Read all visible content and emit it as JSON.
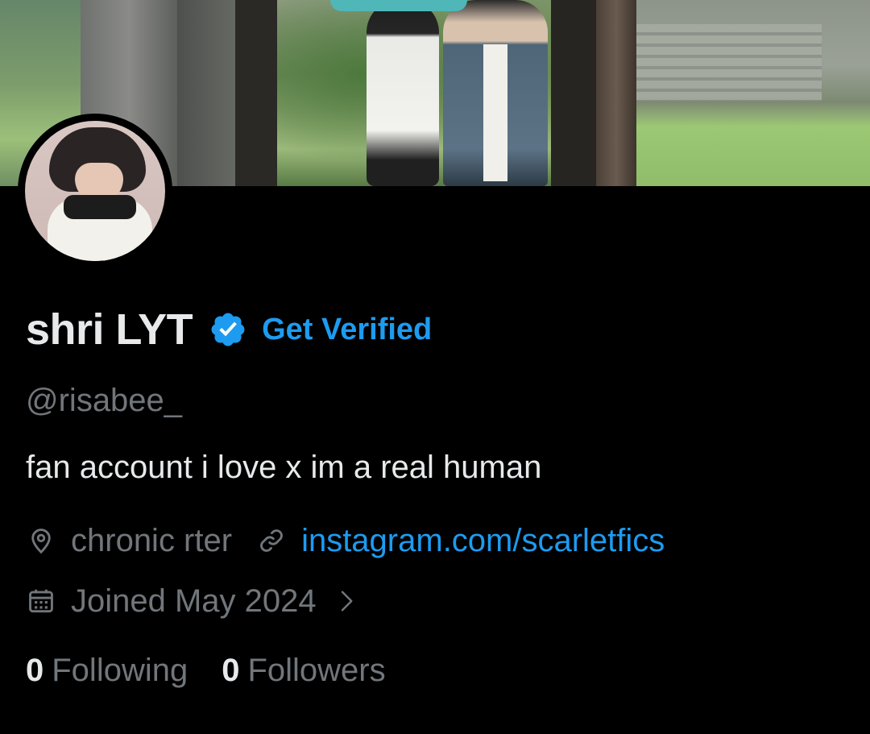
{
  "profile": {
    "display_name": "shri LYT",
    "get_verified_label": "Get Verified",
    "handle": "@risabee_",
    "bio": "fan account i love x im a real human",
    "location": "chronic rter",
    "website": "instagram.com/scarletfics",
    "joined": "Joined May 2024"
  },
  "stats": {
    "following_count": "0",
    "following_label": "Following",
    "followers_count": "0",
    "followers_label": "Followers"
  },
  "icons": {
    "verified": "verified-badge-icon",
    "location": "location-pin-icon",
    "link": "link-icon",
    "calendar": "calendar-icon",
    "chevron": "chevron-right-icon"
  },
  "colors": {
    "background": "#000000",
    "primary_text": "#e7e9ea",
    "secondary_text": "#71767b",
    "accent": "#1d9bf0"
  }
}
